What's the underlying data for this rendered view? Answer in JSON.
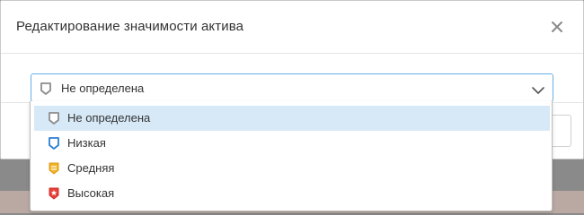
{
  "modal": {
    "title": "Редактирование значимости актива",
    "close_icon": "close-icon"
  },
  "select": {
    "value": "Не определена",
    "icon": "shield-gray-icon"
  },
  "options": [
    {
      "label": "Не определена",
      "icon": "shield-gray-icon",
      "color": "#8c8c8c",
      "selected": true
    },
    {
      "label": "Низкая",
      "icon": "shield-blue-icon",
      "color": "#2b7ed3",
      "selected": false
    },
    {
      "label": "Средняя",
      "icon": "shield-yellow-icon",
      "color": "#f0b429",
      "selected": false
    },
    {
      "label": "Высокая",
      "icon": "shield-red-icon",
      "color": "#e8403a",
      "selected": false
    }
  ],
  "colors": {
    "focus_border": "#66afe9",
    "selected_option_bg": "#d7e9f7"
  }
}
